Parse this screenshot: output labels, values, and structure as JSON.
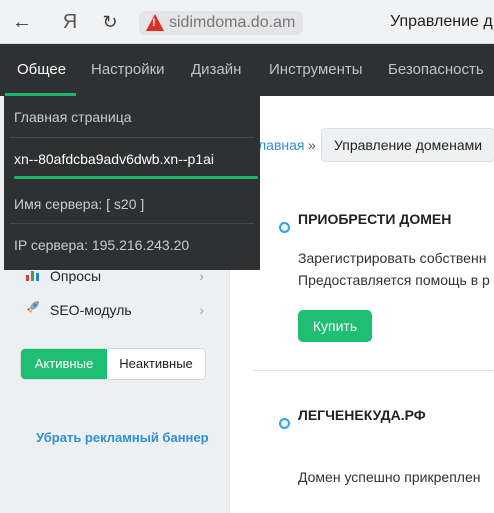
{
  "browser": {
    "back_icon": "←",
    "yandex_icon": "Я",
    "reload_icon": "↻",
    "url": "sidimdoma.do.am",
    "page_title": "Управление д"
  },
  "nav": {
    "tabs": [
      "Общее",
      "Настройки",
      "Дизайн",
      "Инструменты",
      "Безопасность"
    ],
    "active_index": 0
  },
  "dropdown": {
    "items": [
      "Главная страница",
      "xn--80afdcba9adv6dwb.xn--p1ai",
      "Имя сервера: [ s20 ]",
      "IP сервера: 195.216.243.20"
    ],
    "selected_index": 1
  },
  "sidebar": {
    "items": [
      {
        "label": "Опросы",
        "icon": "bar-chart-icon"
      },
      {
        "label": "SEO-модуль",
        "icon": "rocket-icon"
      }
    ],
    "toggle": {
      "active_label": "Активные",
      "inactive_label": "Неактивные"
    },
    "ad_link": "Убрать рекламный баннер"
  },
  "breadcrumb": {
    "home": "лавная",
    "separator": "»",
    "current": "Управление доменами"
  },
  "main": {
    "section1": {
      "title": "ПРИОБРЕСТИ ДОМЕН",
      "line1": "Зарегистрировать собственн",
      "line2": "Предоставляется помощь в р",
      "buy_label": "Купить"
    },
    "section2": {
      "title": "ЛЕГЧЕНЕКУДА.РФ",
      "text": "Домен успешно прикреплен"
    }
  },
  "colors": {
    "accent": "#1fbf73",
    "nav_bg": "#2e3032",
    "link": "#2f8fd8"
  }
}
